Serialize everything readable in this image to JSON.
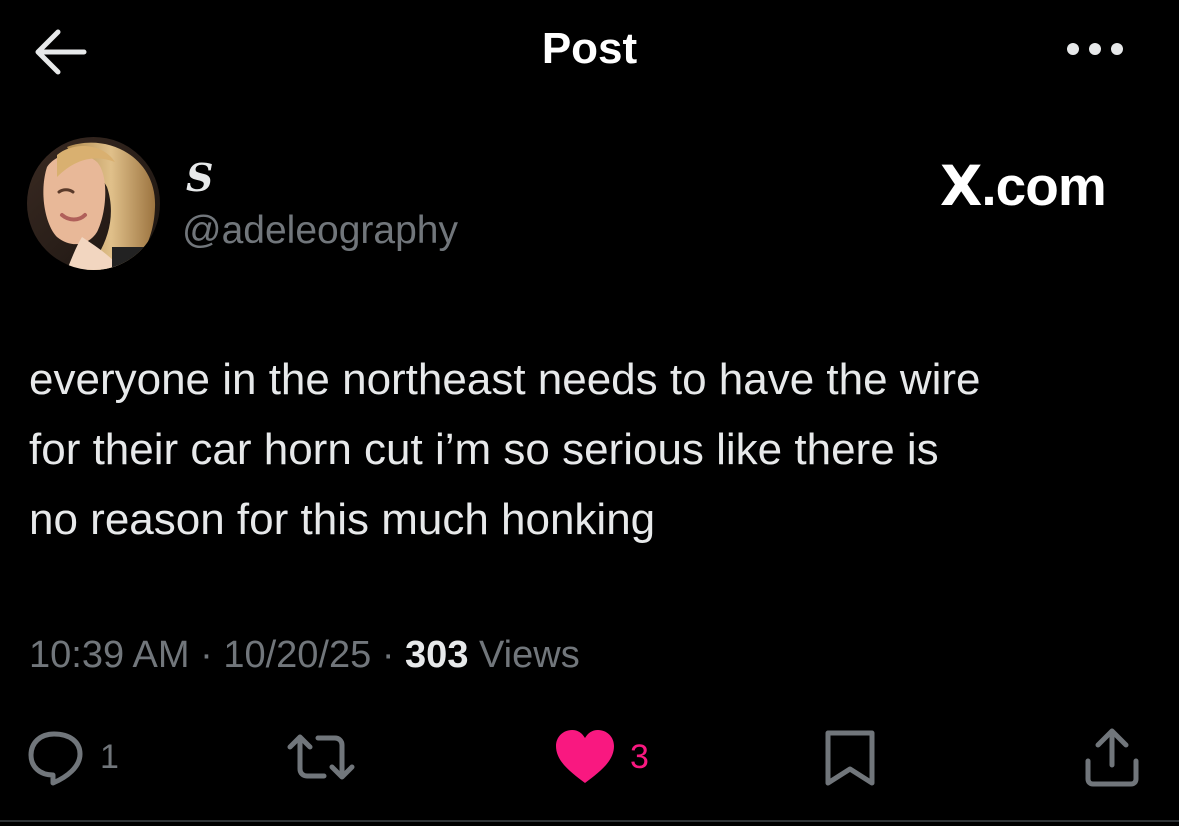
{
  "header": {
    "title": "Post",
    "back_icon": "arrow-left-icon",
    "more_icon": "more-horizontal-icon"
  },
  "author": {
    "display_name": "S",
    "handle": "@adeleography",
    "avatar_icon": "avatar-photo"
  },
  "watermark": {
    "x": "X",
    "domain": ".com"
  },
  "tweet": {
    "line1": "everyone in the northeast needs to have the wire",
    "line2": "for their car horn cut i’m so serious like there is",
    "line3": "no reason for this much honking"
  },
  "meta": {
    "time": "10:39 AM",
    "separator1": " · ",
    "date": "10/20/25",
    "separator2": " · ",
    "views_count": "303",
    "views_label": " Views"
  },
  "actions": {
    "reply": {
      "icon": "reply-bubble-icon",
      "count": "1"
    },
    "repost": {
      "icon": "repost-icon",
      "count": ""
    },
    "like": {
      "icon": "heart-filled-icon",
      "count": "3"
    },
    "bookmark": {
      "icon": "bookmark-icon"
    },
    "share": {
      "icon": "share-icon"
    }
  },
  "colors": {
    "background": "#000000",
    "text": "#e7e9ea",
    "secondary": "#71767b",
    "like": "#f91880"
  }
}
